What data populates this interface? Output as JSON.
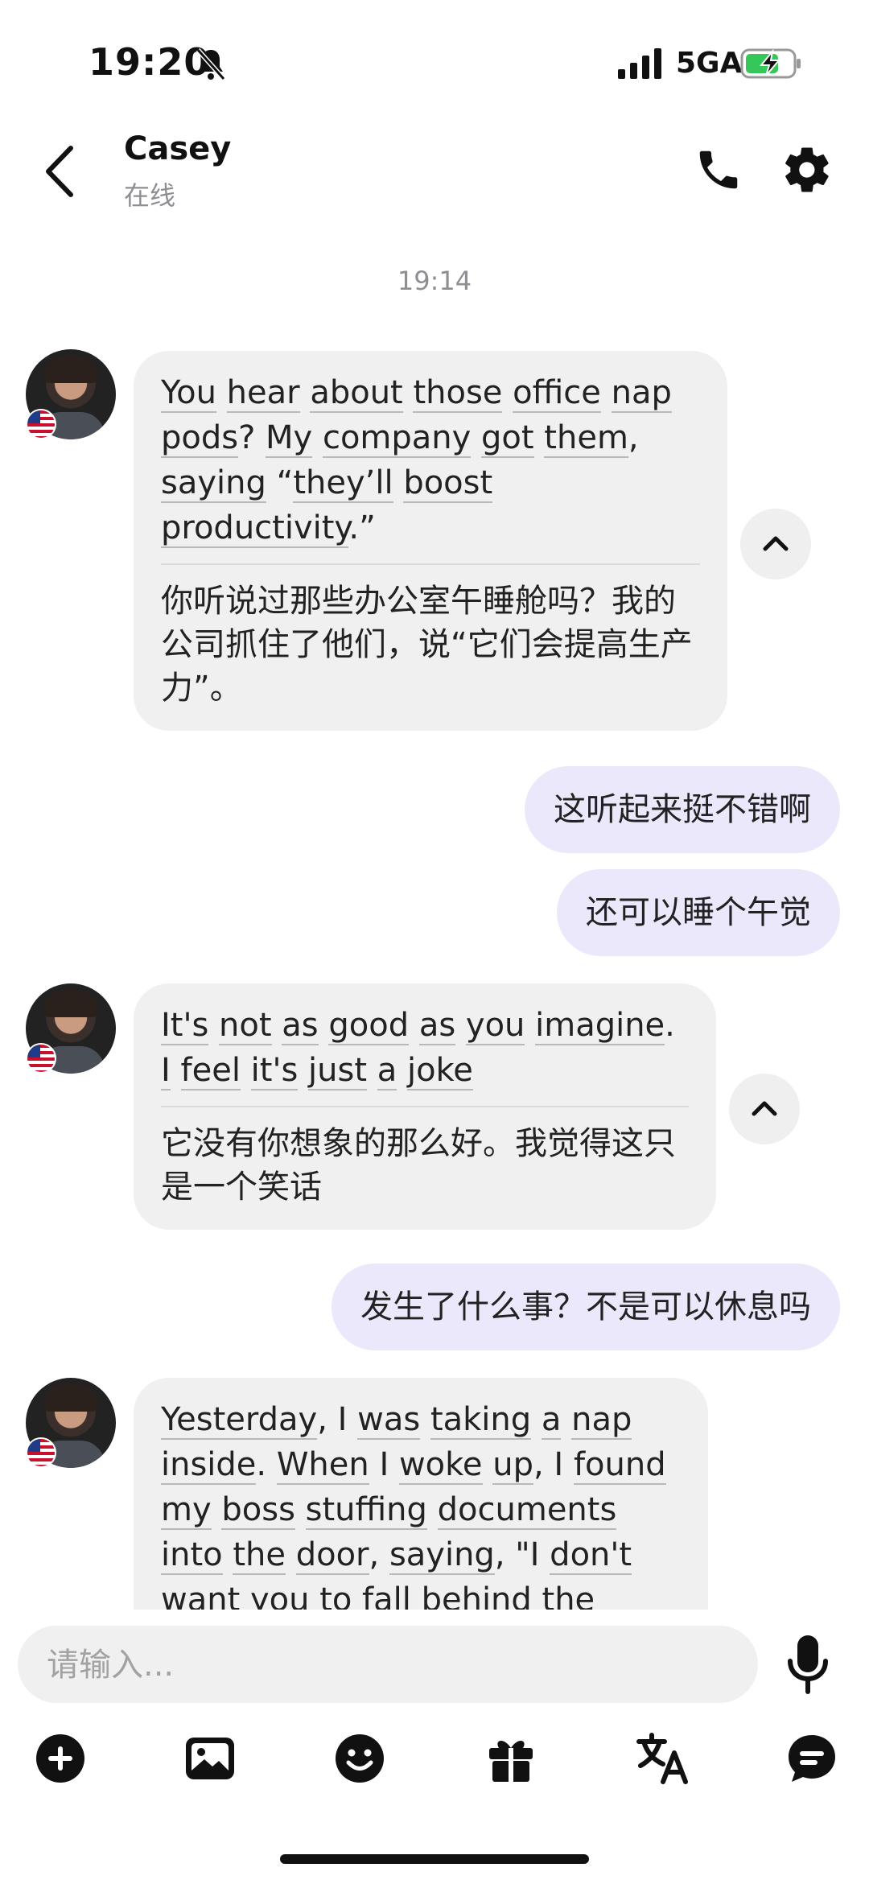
{
  "status_bar": {
    "time": "19:20",
    "network": "5GA",
    "icons": [
      "bell-muted-icon",
      "signal-icon",
      "battery-charging-icon"
    ]
  },
  "header": {
    "contact_name": "Casey",
    "contact_status": "在线",
    "icons": [
      "back-icon",
      "phone-icon",
      "gear-icon"
    ]
  },
  "chat": {
    "timestamp": "19:14",
    "messages": [
      {
        "side": "in",
        "en_lines": [
          [
            "You",
            " ",
            "hear",
            " ",
            "about",
            " ",
            "those",
            " ",
            "office",
            " ",
            "nap"
          ],
          [
            "pods",
            "? ",
            "My",
            " ",
            "company",
            " ",
            "got",
            " ",
            "them",
            ","
          ],
          [
            "saying",
            " “",
            "they’ll",
            " ",
            "boost"
          ],
          [
            "productivity",
            ".”"
          ]
        ],
        "zh": "你听说过那些办公室午睡舱吗？我的公司抓住了他们，说“它们会提高生产力”。"
      },
      {
        "side": "out",
        "text": "这听起来挺不错啊"
      },
      {
        "side": "out",
        "text": "还可以睡个午觉"
      },
      {
        "side": "in",
        "en_lines": [
          [
            "It's",
            " ",
            "not",
            " ",
            "as",
            " ",
            "good",
            " ",
            "as",
            " ",
            "you",
            " ",
            "imagine",
            "."
          ],
          [
            "I",
            " ",
            "feel",
            " ",
            "it's",
            " ",
            "just",
            " ",
            "a",
            " ",
            "joke"
          ]
        ],
        "zh": "它没有你想象的那么好。我觉得这只是一个笑话"
      },
      {
        "side": "out",
        "text": "发生了什么事？不是可以休息吗"
      },
      {
        "side": "in",
        "en_lines": [
          [
            "Yesterday",
            ", I ",
            "was",
            " ",
            "taking",
            " ",
            "a",
            " ",
            "nap"
          ],
          [
            "inside",
            ". ",
            "When",
            " I ",
            "woke",
            " ",
            "up",
            ", I ",
            "found"
          ],
          [
            "my",
            " ",
            "boss",
            " ",
            "stuffing",
            " ",
            "documents"
          ],
          [
            "into",
            " ",
            "the",
            " ",
            "door",
            ", ",
            "saying",
            ", \"I ",
            "don't"
          ],
          [
            "want you to fall behind the"
          ]
        ]
      }
    ]
  },
  "composer": {
    "placeholder": "请输入..."
  },
  "toolbar": {
    "icons": [
      "add-icon",
      "image-icon",
      "emoji-icon",
      "gift-icon",
      "translate-icon",
      "chat-bubble-icon"
    ]
  },
  "colors": {
    "incoming_bubble": "#f0f0f0",
    "outgoing_bubble": "#ebe8fb",
    "text": "#111111",
    "muted": "#8e8e93"
  }
}
